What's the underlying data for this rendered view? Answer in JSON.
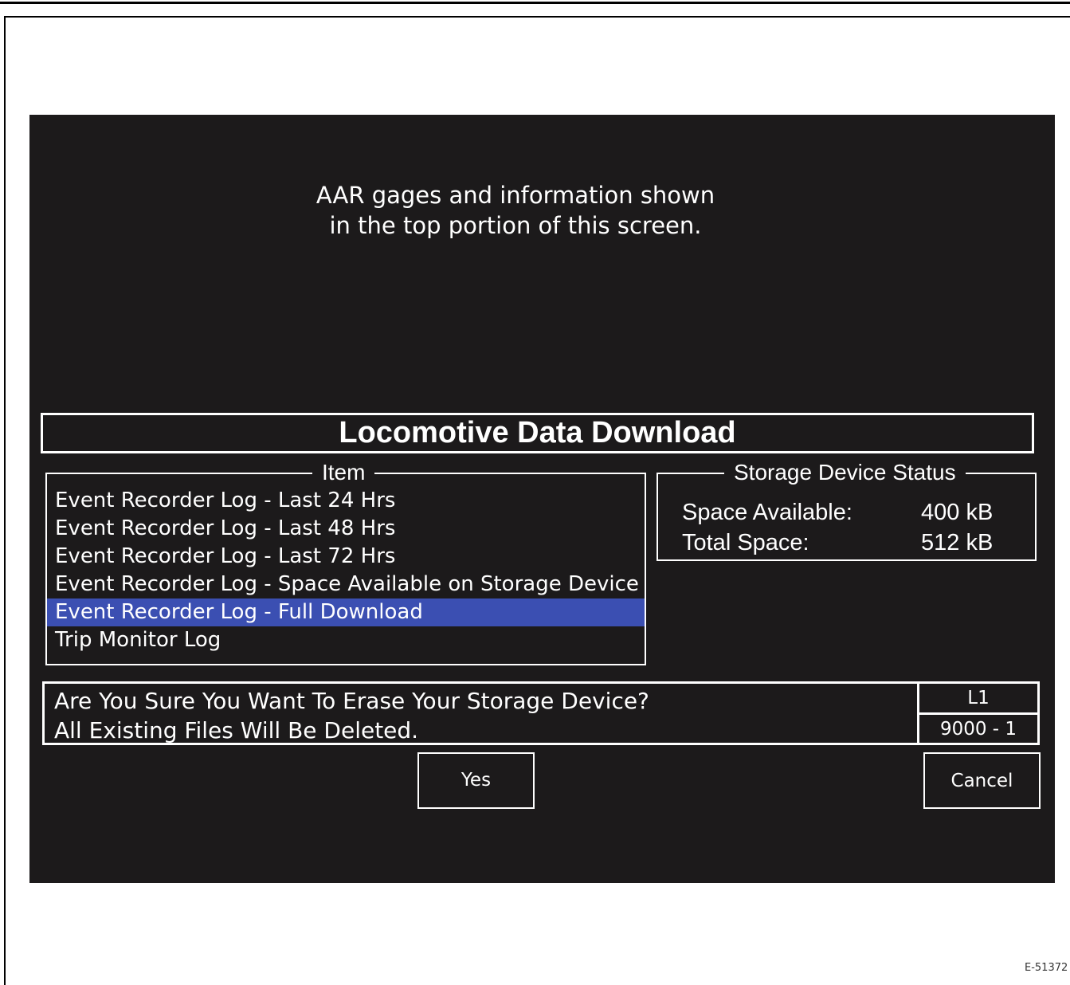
{
  "note": {
    "line1": "AAR gages and information shown",
    "line2": "in the top portion of this screen."
  },
  "title": "Locomotive Data Download",
  "item_panel": {
    "legend": "Item",
    "items": [
      {
        "label": "Event Recorder Log - Last 24 Hrs",
        "selected": false
      },
      {
        "label": "Event Recorder Log - Last 48 Hrs",
        "selected": false
      },
      {
        "label": "Event Recorder Log - Last 72 Hrs",
        "selected": false
      },
      {
        "label": "Event Recorder Log - Space Available on Storage Device",
        "selected": false
      },
      {
        "label": "Event Recorder Log - Full Download",
        "selected": true
      },
      {
        "label": "Trip Monitor Log",
        "selected": false
      }
    ]
  },
  "storage_status": {
    "legend": "Storage Device Status",
    "space_available_label": "Space Available:",
    "space_available_value": "400 kB",
    "total_space_label": "Total Space:",
    "total_space_value": "512 kB"
  },
  "message": {
    "line1": "Are You Sure You Want To Erase Your Storage Device?",
    "line2": "All Existing Files Will Be Deleted."
  },
  "side_info": {
    "top": "L1",
    "bottom": "9000 - 1"
  },
  "buttons": {
    "yes": "Yes",
    "cancel": "Cancel"
  },
  "colors": {
    "screen_bg": "#1c1a1b",
    "selection": "#3b4fb2"
  },
  "figure_id": "E-51372"
}
